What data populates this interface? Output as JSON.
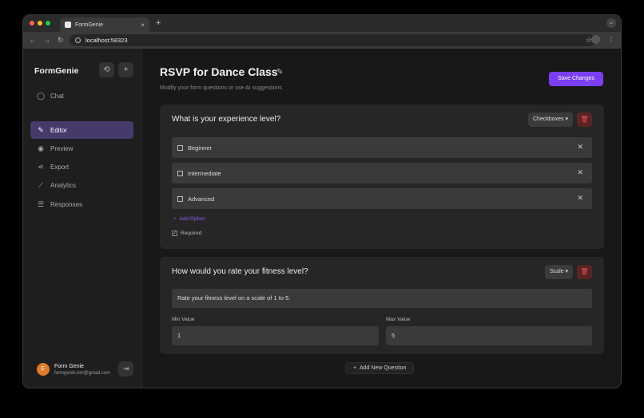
{
  "browser": {
    "tab_title": "FormGenie",
    "tab_close": "×",
    "new_tab": "+",
    "url": "localhost:58323",
    "traffic_colors": [
      "#ff5f57",
      "#febc2e",
      "#28c840"
    ]
  },
  "sidebar": {
    "brand": "FormGenie",
    "history_icon": "history-icon",
    "new_icon": "plus-icon",
    "items": [
      {
        "label": "Chat",
        "icon": "chat-icon"
      },
      {
        "label": "Editor",
        "icon": "edit-icon",
        "active": true
      },
      {
        "label": "Preview",
        "icon": "eye-icon"
      },
      {
        "label": "Export",
        "icon": "share-icon"
      },
      {
        "label": "Analytics",
        "icon": "chart-icon"
      },
      {
        "label": "Responses",
        "icon": "list-icon"
      }
    ],
    "user": {
      "initial": "F",
      "name": "Form Genie",
      "email": "formgenie.bm@gmail.com"
    }
  },
  "header": {
    "title": "RSVP for Dance Class",
    "subtitle": "Modify your form questions or use AI suggestions",
    "save_label": "Save Changes"
  },
  "questions": [
    {
      "title": "What is your experience level?",
      "type": "Checkboxes",
      "options": [
        "Beginner",
        "Intermediate",
        "Advanced"
      ],
      "add_option_label": "Add Option",
      "required_label": "Required"
    },
    {
      "title": "How would you rate your fitness level?",
      "type": "Scale",
      "description": "Rate your fitness level on a scale of 1 to 5.",
      "min_label": "Min Value",
      "min_value": "1",
      "max_label": "Max Value",
      "max_value": "5"
    }
  ],
  "footer": {
    "add_question_label": "Add New Question"
  },
  "colors": {
    "accent": "#7b3ff2",
    "active_nav": "#463a6c",
    "danger": "#e05555"
  }
}
